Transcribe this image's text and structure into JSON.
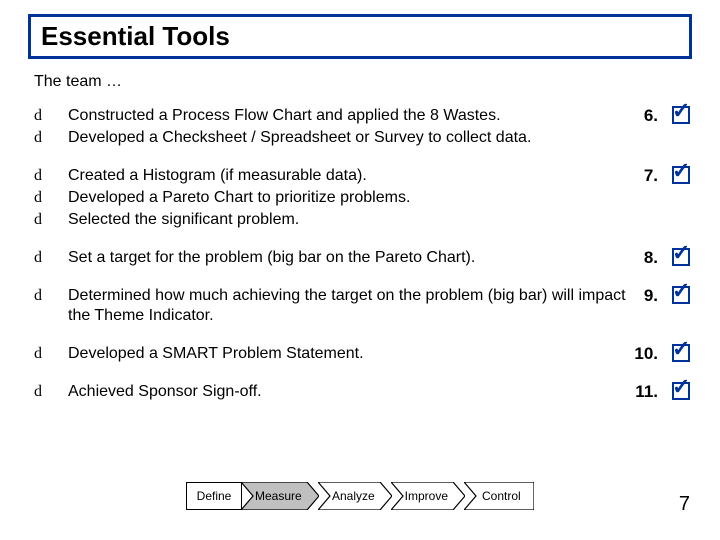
{
  "title": "Essential Tools",
  "intro": "The team …",
  "bullet_glyph": "d",
  "groups": [
    {
      "number": "6.",
      "items": [
        "Constructed a Process Flow Chart and applied the 8 Wastes.",
        "Developed a Checksheet / Spreadsheet or Survey to collect data."
      ]
    },
    {
      "number": "7.",
      "items": [
        "Created a Histogram (if measurable data).",
        "Developed a Pareto Chart to prioritize problems.",
        "Selected the significant problem."
      ]
    },
    {
      "number": "8.",
      "items": [
        "Set a target for the problem (big bar on the Pareto Chart)."
      ]
    },
    {
      "number": "9.",
      "items": [
        "Determined how much achieving the target on the problem (big bar) will impact the Theme Indicator."
      ]
    },
    {
      "number": "10.",
      "items": [
        "Developed a SMART Problem Statement."
      ]
    },
    {
      "number": "11.",
      "items": [
        "Achieved Sponsor Sign-off."
      ]
    }
  ],
  "phases": {
    "define": "Define",
    "measure": "Measure",
    "analyze": "Analyze",
    "improve": "Improve",
    "control": "Control"
  },
  "page_number": "7",
  "checkmark_glyph": "✓"
}
